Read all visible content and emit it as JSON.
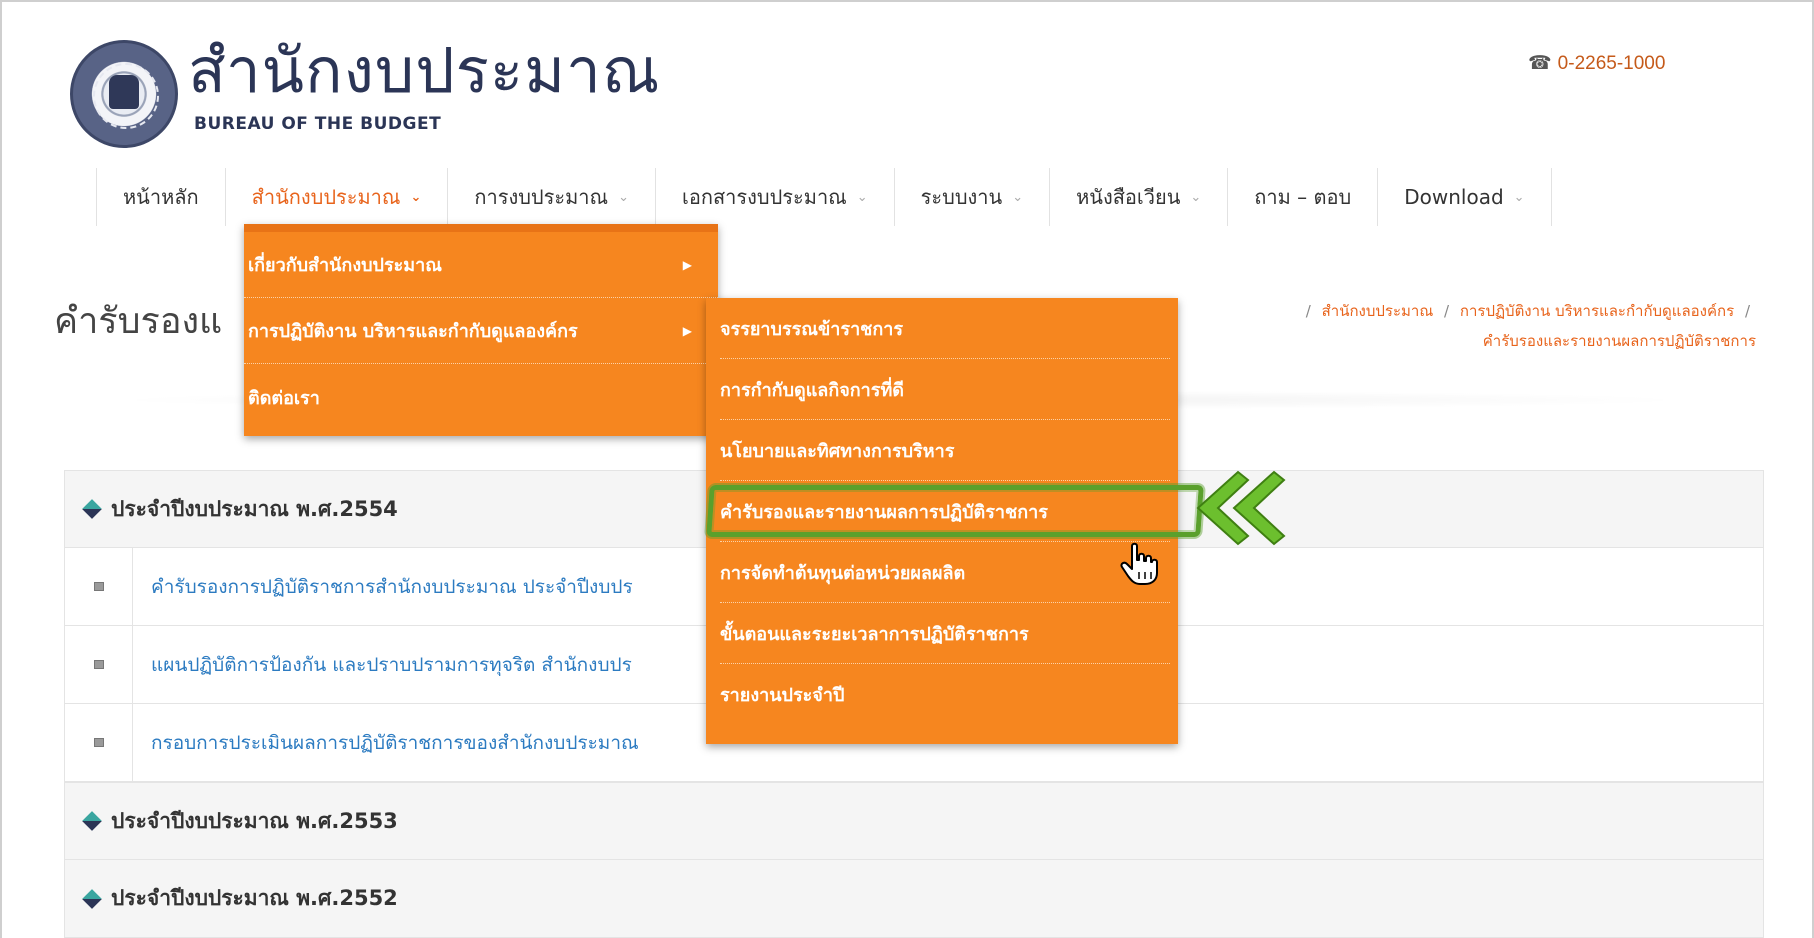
{
  "header": {
    "logo_th": "สำนักงบประมาณ",
    "logo_en": "BUREAU OF THE BUDGET",
    "phone": "0-2265-1000"
  },
  "nav": {
    "items": [
      {
        "label": "หน้าหลัก",
        "has_dropdown": false
      },
      {
        "label": "สำนักงบประมาณ",
        "has_dropdown": true,
        "active": true
      },
      {
        "label": "การงบประมาณ",
        "has_dropdown": true
      },
      {
        "label": "เอกสารงบประมาณ",
        "has_dropdown": true
      },
      {
        "label": "ระบบงาน",
        "has_dropdown": true
      },
      {
        "label": "หนังสือเวียน",
        "has_dropdown": true
      },
      {
        "label": "ถาม – ตอบ",
        "has_dropdown": false
      },
      {
        "label": "Download",
        "has_dropdown": true
      }
    ]
  },
  "page": {
    "title": "คำรับรองแ",
    "breadcrumb": [
      "สำนักงบประมาณ",
      "การปฏิบัติงาน บริหารและกำกับดูแลองค์กร",
      "คำรับรองและรายงานผลการปฏิบัติราชการ"
    ]
  },
  "dropdown": {
    "level1": [
      {
        "label": "เกี่ยวกับสำนักงบประมาณ",
        "has_submenu": true
      },
      {
        "label": "การปฏิบัติงาน บริหารและกำกับดูแลองค์กร",
        "has_submenu": true
      },
      {
        "label": "ติดต่อเรา",
        "has_submenu": false
      }
    ],
    "level2": [
      {
        "label": "จรรยาบรรณข้าราชการ"
      },
      {
        "label": "การกำกับดูแลกิจการที่ดี"
      },
      {
        "label": "นโยบายและทิศทางการบริหาร"
      },
      {
        "label": "คำรับรองและรายงานผลการปฏิบัติราชการ",
        "highlighted": true
      },
      {
        "label": "การจัดทำต้นทุนต่อหน่วยผลผลิต"
      },
      {
        "label": "ขั้นตอนและระยะเวลาการปฏิบัติราชการ"
      },
      {
        "label": "รายงานประจำปี"
      }
    ]
  },
  "content": {
    "years": [
      {
        "label": "ประจำปีงบประมาณ พ.ศ.2554",
        "docs": [
          "คำรับรองการปฏิบัติราชการสำนักงบประมาณ ประจำปีงบปร",
          "แผนปฏิบัติการป้องกัน และปราบปรามการทุจริต สำนักงบปร",
          "กรอบการประเมินผลการปฏิบัติราชการของสำนักงบประมาณ"
        ]
      },
      {
        "label": "ประจำปีงบประมาณ พ.ศ.2553",
        "docs": []
      },
      {
        "label": "ประจำปีงบประมาณ พ.ศ.2552",
        "docs": []
      }
    ]
  },
  "colors": {
    "menu_orange": "#f6861f",
    "accent_orange": "#e8641c",
    "annotation_green": "#5aa02c",
    "link_blue": "#2c7bc1"
  }
}
